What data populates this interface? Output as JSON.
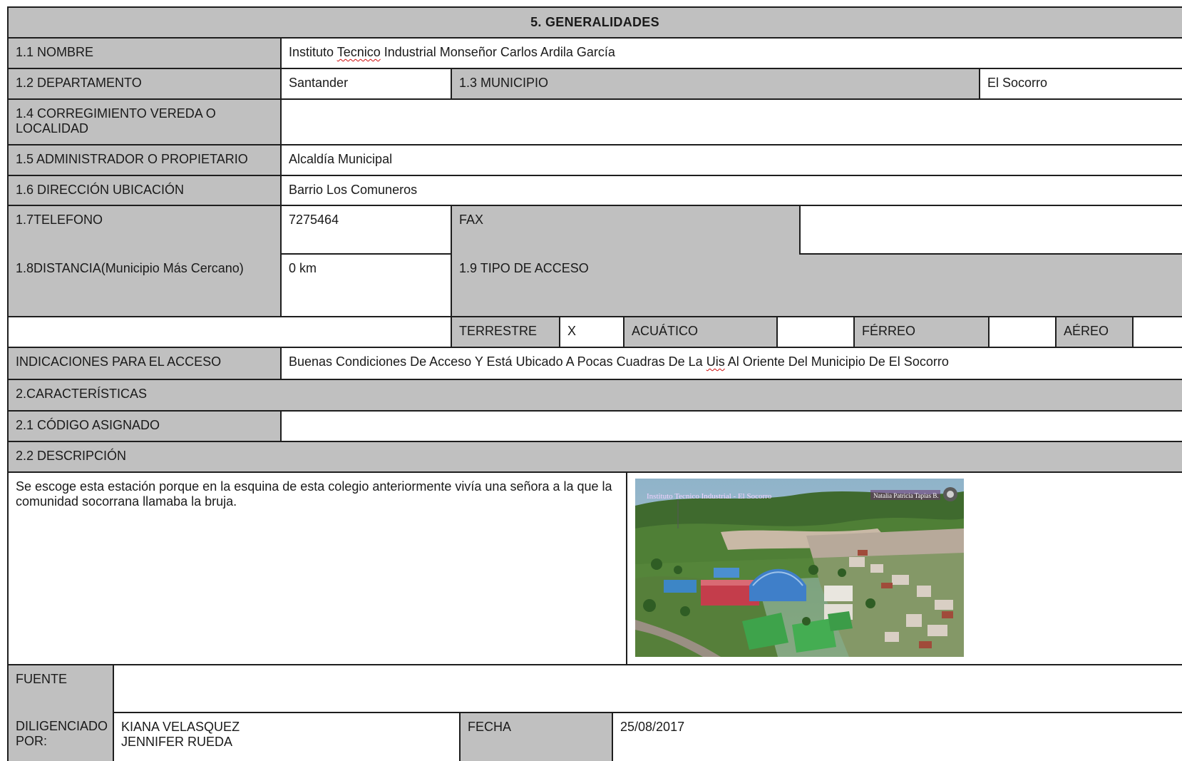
{
  "header": {
    "title": "5. GENERALIDADES"
  },
  "rows": {
    "nombre": {
      "label": "1.1 NOMBRE",
      "value_parts": [
        "Instituto ",
        "Tecnico",
        " Industrial Monseñor Carlos Ardila García"
      ]
    },
    "departamento": {
      "label": "1.2 DEPARTAMENTO",
      "value": "Santander"
    },
    "municipio": {
      "label": "1.3 MUNICIPIO",
      "value": "El Socorro"
    },
    "corregimiento": {
      "label": "1.4 CORREGIMIENTO VEREDA O LOCALIDAD",
      "value": ""
    },
    "administrador": {
      "label": "1.5 ADMINISTRADOR O PROPIETARIO",
      "value": "Alcaldía Municipal"
    },
    "direccion": {
      "label": "1.6 DIRECCIÓN UBICACIÓN",
      "value": "Barrio Los Comuneros"
    },
    "telefono": {
      "label": "1.7TELEFONO",
      "value": "7275464"
    },
    "fax": {
      "label": "FAX",
      "value": ""
    },
    "distancia": {
      "label": "1.8DISTANCIA(Municipio Más Cercano)",
      "value": "0 km"
    },
    "tipo_acceso": {
      "label": "1.9 TIPO DE ACCESO",
      "options": [
        {
          "label": "TERRESTRE",
          "mark": "X"
        },
        {
          "label": "ACUÁTICO",
          "mark": ""
        },
        {
          "label": "FÉRREO",
          "mark": ""
        },
        {
          "label": "AÉREO",
          "mark": ""
        }
      ]
    },
    "indicaciones": {
      "label": "INDICACIONES PARA EL ACCESO",
      "value_parts": [
        "Buenas Condiciones De Acceso Y Está Ubicado A Pocas Cuadras De La ",
        "Uis",
        " Al Oriente Del Municipio De El Socorro"
      ]
    }
  },
  "caracteristicas": {
    "title": "2.CARACTERÍSTICAS",
    "codigo": {
      "label": "2.1 CÓDIGO ASIGNADO",
      "value": ""
    },
    "descripcion": {
      "label": "2.2 DESCRIPCIÓN",
      "text": "Se escoge esta estación porque en la esquina de esta colegio anteriormente vivía una señora a la que la comunidad socorrana llamaba la bruja.",
      "photo": {
        "caption_left": "Instituto Tecnico Industrial - El Socorro",
        "caption_right": "Natalia Patricia Tapias B."
      }
    }
  },
  "footer": {
    "fuente": {
      "label": "FUENTE",
      "value": ""
    },
    "diligenciado": {
      "label": "DILIGENCIADO POR:",
      "names": [
        "KIANA VELASQUEZ",
        "JENNIFER RUEDA"
      ]
    },
    "fecha": {
      "label": "FECHA",
      "value": "25/08/2017"
    }
  },
  "colors": {
    "cell_gray": "#c0c0c0",
    "border": "#1e1e1e",
    "spell_underline": "#d01010"
  }
}
